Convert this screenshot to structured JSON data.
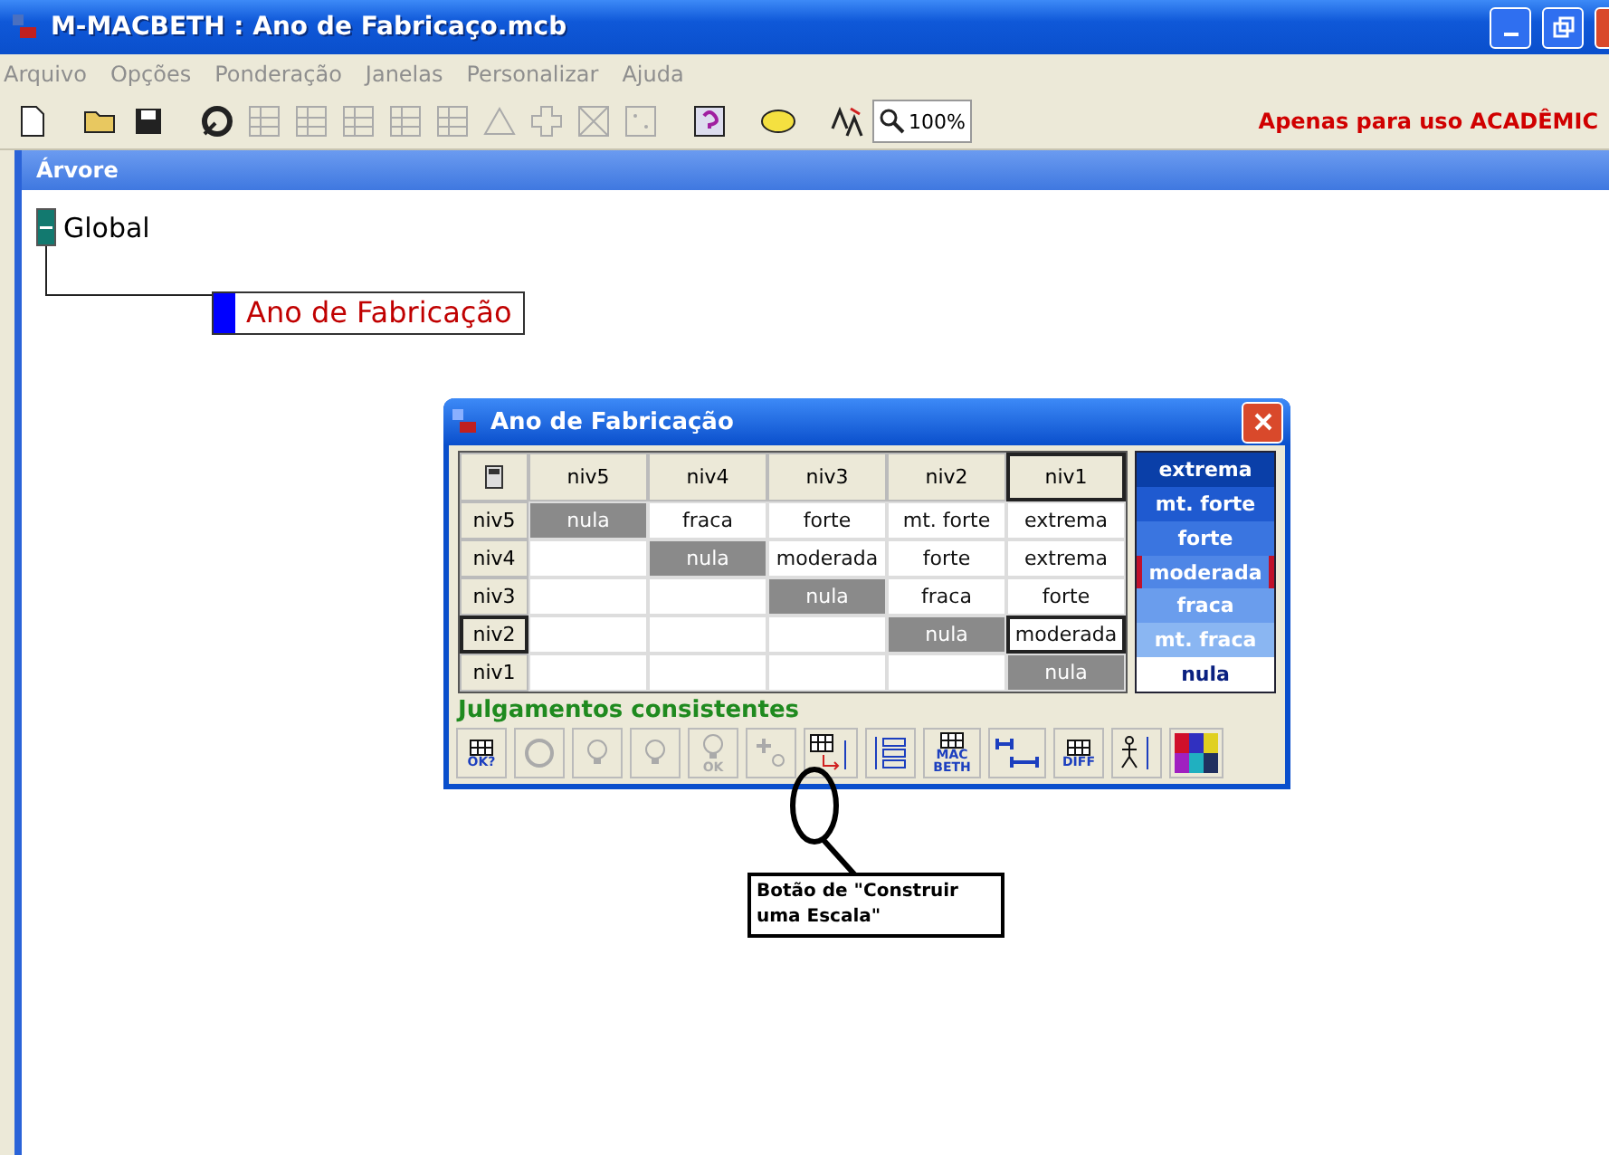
{
  "window": {
    "title": "M-MACBETH : Ano de Fabricaço.mcb"
  },
  "menu": [
    "Arquivo",
    "Opções",
    "Ponderação",
    "Janelas",
    "Personalizar",
    "Ajuda"
  ],
  "toolbar": [
    {
      "kind": "new",
      "disabled": false
    },
    {
      "kind": "open",
      "disabled": false
    },
    {
      "kind": "save",
      "disabled": false
    },
    {
      "kind": "swirl",
      "disabled": false
    },
    {
      "kind": "swap",
      "disabled": true
    },
    {
      "kind": "grid",
      "disabled": true
    },
    {
      "kind": "ladder",
      "disabled": true
    },
    {
      "kind": "bars",
      "disabled": true
    },
    {
      "kind": "fork",
      "disabled": true
    },
    {
      "kind": "triangle",
      "disabled": true
    },
    {
      "kind": "plus",
      "disabled": true
    },
    {
      "kind": "cross",
      "disabled": true
    },
    {
      "kind": "dots",
      "disabled": true
    },
    {
      "kind": "question",
      "disabled": false
    },
    {
      "kind": "oval",
      "disabled": false
    },
    {
      "kind": "font",
      "disabled": false
    }
  ],
  "zoom": "100%",
  "notice": "Apenas para uso ACADÊMIC",
  "tree_window": {
    "title": "Árvore",
    "root": {
      "label": "Global",
      "expanded": true,
      "children": [
        {
          "label": "Ano de Fabricação",
          "selected": true
        }
      ]
    }
  },
  "dialog": {
    "title": "Ano de Fabricação",
    "columns": [
      {
        "label": "niv5",
        "selected": false
      },
      {
        "label": "niv4",
        "selected": false
      },
      {
        "label": "niv3",
        "selected": false
      },
      {
        "label": "niv2",
        "selected": false
      },
      {
        "label": "niv1",
        "selected": true
      }
    ],
    "rows": [
      {
        "label": "niv5",
        "selected": false,
        "cells": [
          "nula",
          "fraca",
          "forte",
          "mt. forte",
          "extrema"
        ]
      },
      {
        "label": "niv4",
        "selected": false,
        "cells": [
          null,
          "nula",
          "moderada",
          "forte",
          "extrema"
        ]
      },
      {
        "label": "niv3",
        "selected": false,
        "cells": [
          null,
          null,
          "nula",
          "fraca",
          "forte"
        ]
      },
      {
        "label": "niv2",
        "selected": true,
        "cells": [
          null,
          null,
          null,
          "nula",
          "moderada"
        ]
      },
      {
        "label": "niv1",
        "selected": false,
        "cells": [
          null,
          null,
          null,
          null,
          "nula"
        ]
      }
    ],
    "scale": [
      {
        "label": "extrema",
        "color": "#0a3fa8",
        "selected": false
      },
      {
        "label": "mt. forte",
        "color": "#1f5ad0",
        "selected": false
      },
      {
        "label": "forte",
        "color": "#3a75e0",
        "selected": false
      },
      {
        "label": "moderada",
        "color": "#4f86e6",
        "selected": true
      },
      {
        "label": "fraca",
        "color": "#6a9ded",
        "selected": false
      },
      {
        "label": "mt. fraca",
        "color": "#8ab6f2",
        "selected": false
      },
      {
        "label": "nula",
        "color": "#ffffff",
        "selected": false
      }
    ],
    "status": "Julgamentos consistentes",
    "tools": [
      {
        "kind": "check",
        "label": "OK?",
        "disabled": false
      },
      {
        "kind": "refresh",
        "disabled": true
      },
      {
        "kind": "bulb",
        "disabled": true
      },
      {
        "kind": "bulb",
        "disabled": true
      },
      {
        "kind": "bulb",
        "label": "OK",
        "disabled": true
      },
      {
        "kind": "plus",
        "disabled": true
      },
      {
        "kind": "build",
        "disabled": false
      },
      {
        "kind": "list",
        "disabled": false
      },
      {
        "kind": "macbeth",
        "label": "MAC BETH",
        "disabled": false
      },
      {
        "kind": "range",
        "disabled": false
      },
      {
        "kind": "diff",
        "label": "DIFF",
        "disabled": false
      },
      {
        "kind": "figure",
        "disabled": false
      },
      {
        "kind": "colors",
        "disabled": false
      }
    ]
  },
  "callout": "Botão de \"Construir uma Escala\""
}
